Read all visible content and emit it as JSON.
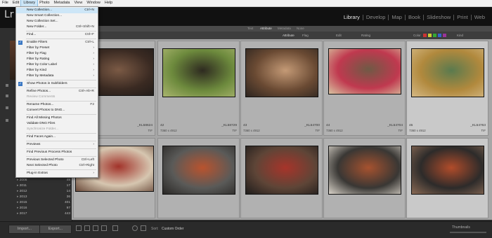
{
  "os_menubar": [
    "File",
    "Edit",
    "Library",
    "Photo",
    "Metadata",
    "View",
    "Window",
    "Help"
  ],
  "app": {
    "logo": "Lr"
  },
  "modules": [
    {
      "label": "Library",
      "active": true
    },
    {
      "label": "Develop",
      "active": false
    },
    {
      "label": "Map",
      "active": false
    },
    {
      "label": "Book",
      "active": false
    },
    {
      "label": "Slideshow",
      "active": false
    },
    {
      "label": "Print",
      "active": false
    },
    {
      "label": "Web",
      "active": false
    }
  ],
  "filter_bar": {
    "tabs": [
      "Text",
      "Attribute",
      "Metadata",
      "None"
    ]
  },
  "library_bar": {
    "attribute_label": "Attribute",
    "flag_label": "Flag",
    "rating_label": "Rating",
    "edit_label": "Edit",
    "color_label": "Color",
    "kind_label": "Kind"
  },
  "left_panel": {
    "folders": [
      {
        "name": "2006",
        "count": "49"
      },
      {
        "name": "2011",
        "count": "17"
      },
      {
        "name": "2012",
        "count": "14"
      },
      {
        "name": "2013",
        "count": "36"
      },
      {
        "name": "2015",
        "count": "401"
      },
      {
        "name": "2016",
        "count": "97"
      },
      {
        "name": "2017",
        "count": "443"
      }
    ]
  },
  "library_menu": [
    {
      "label": "New Collection...",
      "shortcut": "Ctrl+N",
      "highlighted": true
    },
    {
      "label": "New Smart Collection..."
    },
    {
      "label": "New Collection Set..."
    },
    {
      "label": "New Folder...",
      "shortcut": "Ctrl+Shift+N"
    },
    {
      "sep": true
    },
    {
      "label": "Find...",
      "shortcut": "Ctrl+F"
    },
    {
      "sep": true
    },
    {
      "label": "Enable Filters",
      "shortcut": "Ctrl+L",
      "checked": true
    },
    {
      "label": "Filter by Preset",
      "submenu": true
    },
    {
      "label": "Filter by Flag",
      "submenu": true
    },
    {
      "label": "Filter by Rating",
      "submenu": true
    },
    {
      "label": "Filter by Color Label",
      "submenu": true
    },
    {
      "label": "Filter by Kind",
      "submenu": true
    },
    {
      "label": "Filter by Metadata",
      "submenu": true
    },
    {
      "sep": true
    },
    {
      "label": "Show Photos in Subfolders",
      "checked": true
    },
    {
      "sep": true
    },
    {
      "label": "Refine Photos...",
      "shortcut": "Ctrl+Alt+R"
    },
    {
      "label": "Review Comments",
      "disabled": true
    },
    {
      "sep": true
    },
    {
      "label": "Rename Photos...",
      "shortcut": "F2"
    },
    {
      "label": "Convert Photos to DNG..."
    },
    {
      "sep": true
    },
    {
      "label": "Find All Missing Photos"
    },
    {
      "label": "Validate DNG Files"
    },
    {
      "label": "Synchronize Folder...",
      "disabled": true
    },
    {
      "sep": true
    },
    {
      "label": "Find Faces Again..."
    },
    {
      "sep": true
    },
    {
      "label": "Previews",
      "submenu": true
    },
    {
      "sep": true
    },
    {
      "label": "Find Previous Process Photos"
    },
    {
      "sep": true
    },
    {
      "label": "Previous Selected Photo",
      "shortcut": "Ctrl+Left"
    },
    {
      "label": "Next Selected Photo",
      "shortcut": "Ctrl+Right"
    },
    {
      "sep": true
    },
    {
      "label": "Plug-in Extras",
      "submenu": true
    }
  ],
  "grid": {
    "row1": [
      {
        "index": "",
        "filename": "_KL58624",
        "dims": "",
        "ext": "TIF",
        "selected": false,
        "photo": {
          "w": 112,
          "h": 68,
          "colors": [
            "#3a2a22",
            "#7b5a45",
            "#1d1a18"
          ]
        }
      },
      {
        "index": "42",
        "filename": "_KL58729",
        "dims": "7360 x 4912",
        "ext": "TIF",
        "selected": false,
        "photo": {
          "w": 104,
          "h": 70,
          "colors": [
            "#6d8a3d",
            "#2e2a20",
            "#a9b56e"
          ]
        }
      },
      {
        "index": "43",
        "filename": "_KL54700",
        "dims": "7360 x 4912",
        "ext": "TIF",
        "selected": false,
        "photo": {
          "w": 104,
          "h": 70,
          "colors": [
            "#6a4a33",
            "#c49a76",
            "#2d2520"
          ]
        }
      },
      {
        "index": "44",
        "filename": "_KL54704",
        "dims": "7360 x 4912",
        "ext": "TIF",
        "selected": false,
        "photo": {
          "w": 104,
          "h": 66,
          "colors": [
            "#c0394f",
            "#6f5a45",
            "#d8c2a0"
          ]
        }
      },
      {
        "index": "45",
        "filename": "_KL54763",
        "dims": "7360 x 4912",
        "ext": "TIF",
        "selected": true,
        "photo": {
          "w": 104,
          "h": 70,
          "colors": [
            "#b1893d",
            "#5a7a4e",
            "#d4b884"
          ]
        }
      }
    ],
    "row2": [
      {
        "photo": {
          "w": 112,
          "h": 66,
          "colors": [
            "#d6c6b0",
            "#a2332a",
            "#6a4a3a"
          ]
        },
        "selected": false
      },
      {
        "photo": {
          "w": 104,
          "h": 70,
          "colors": [
            "#5a5a58",
            "#b9532e",
            "#2a2826"
          ]
        },
        "selected": false
      },
      {
        "photo": {
          "w": 104,
          "h": 70,
          "colors": [
            "#5e4537",
            "#a7342a",
            "#1f1d1c"
          ]
        },
        "selected": false
      },
      {
        "photo": {
          "w": 104,
          "h": 70,
          "colors": [
            "#393734",
            "#a6522f",
            "#d9d3c9"
          ]
        },
        "selected": false
      },
      {
        "photo": {
          "w": 104,
          "h": 70,
          "colors": [
            "#2d2b2a",
            "#b14c2a",
            "#8a6a55"
          ]
        },
        "selected": true
      }
    ]
  },
  "bottom_bar": {
    "import_label": "Import...",
    "export_label": "Export...",
    "sort_label": "Sort:",
    "sort_value": "Custom Order",
    "thumbnails_label": "Thumbnails"
  }
}
